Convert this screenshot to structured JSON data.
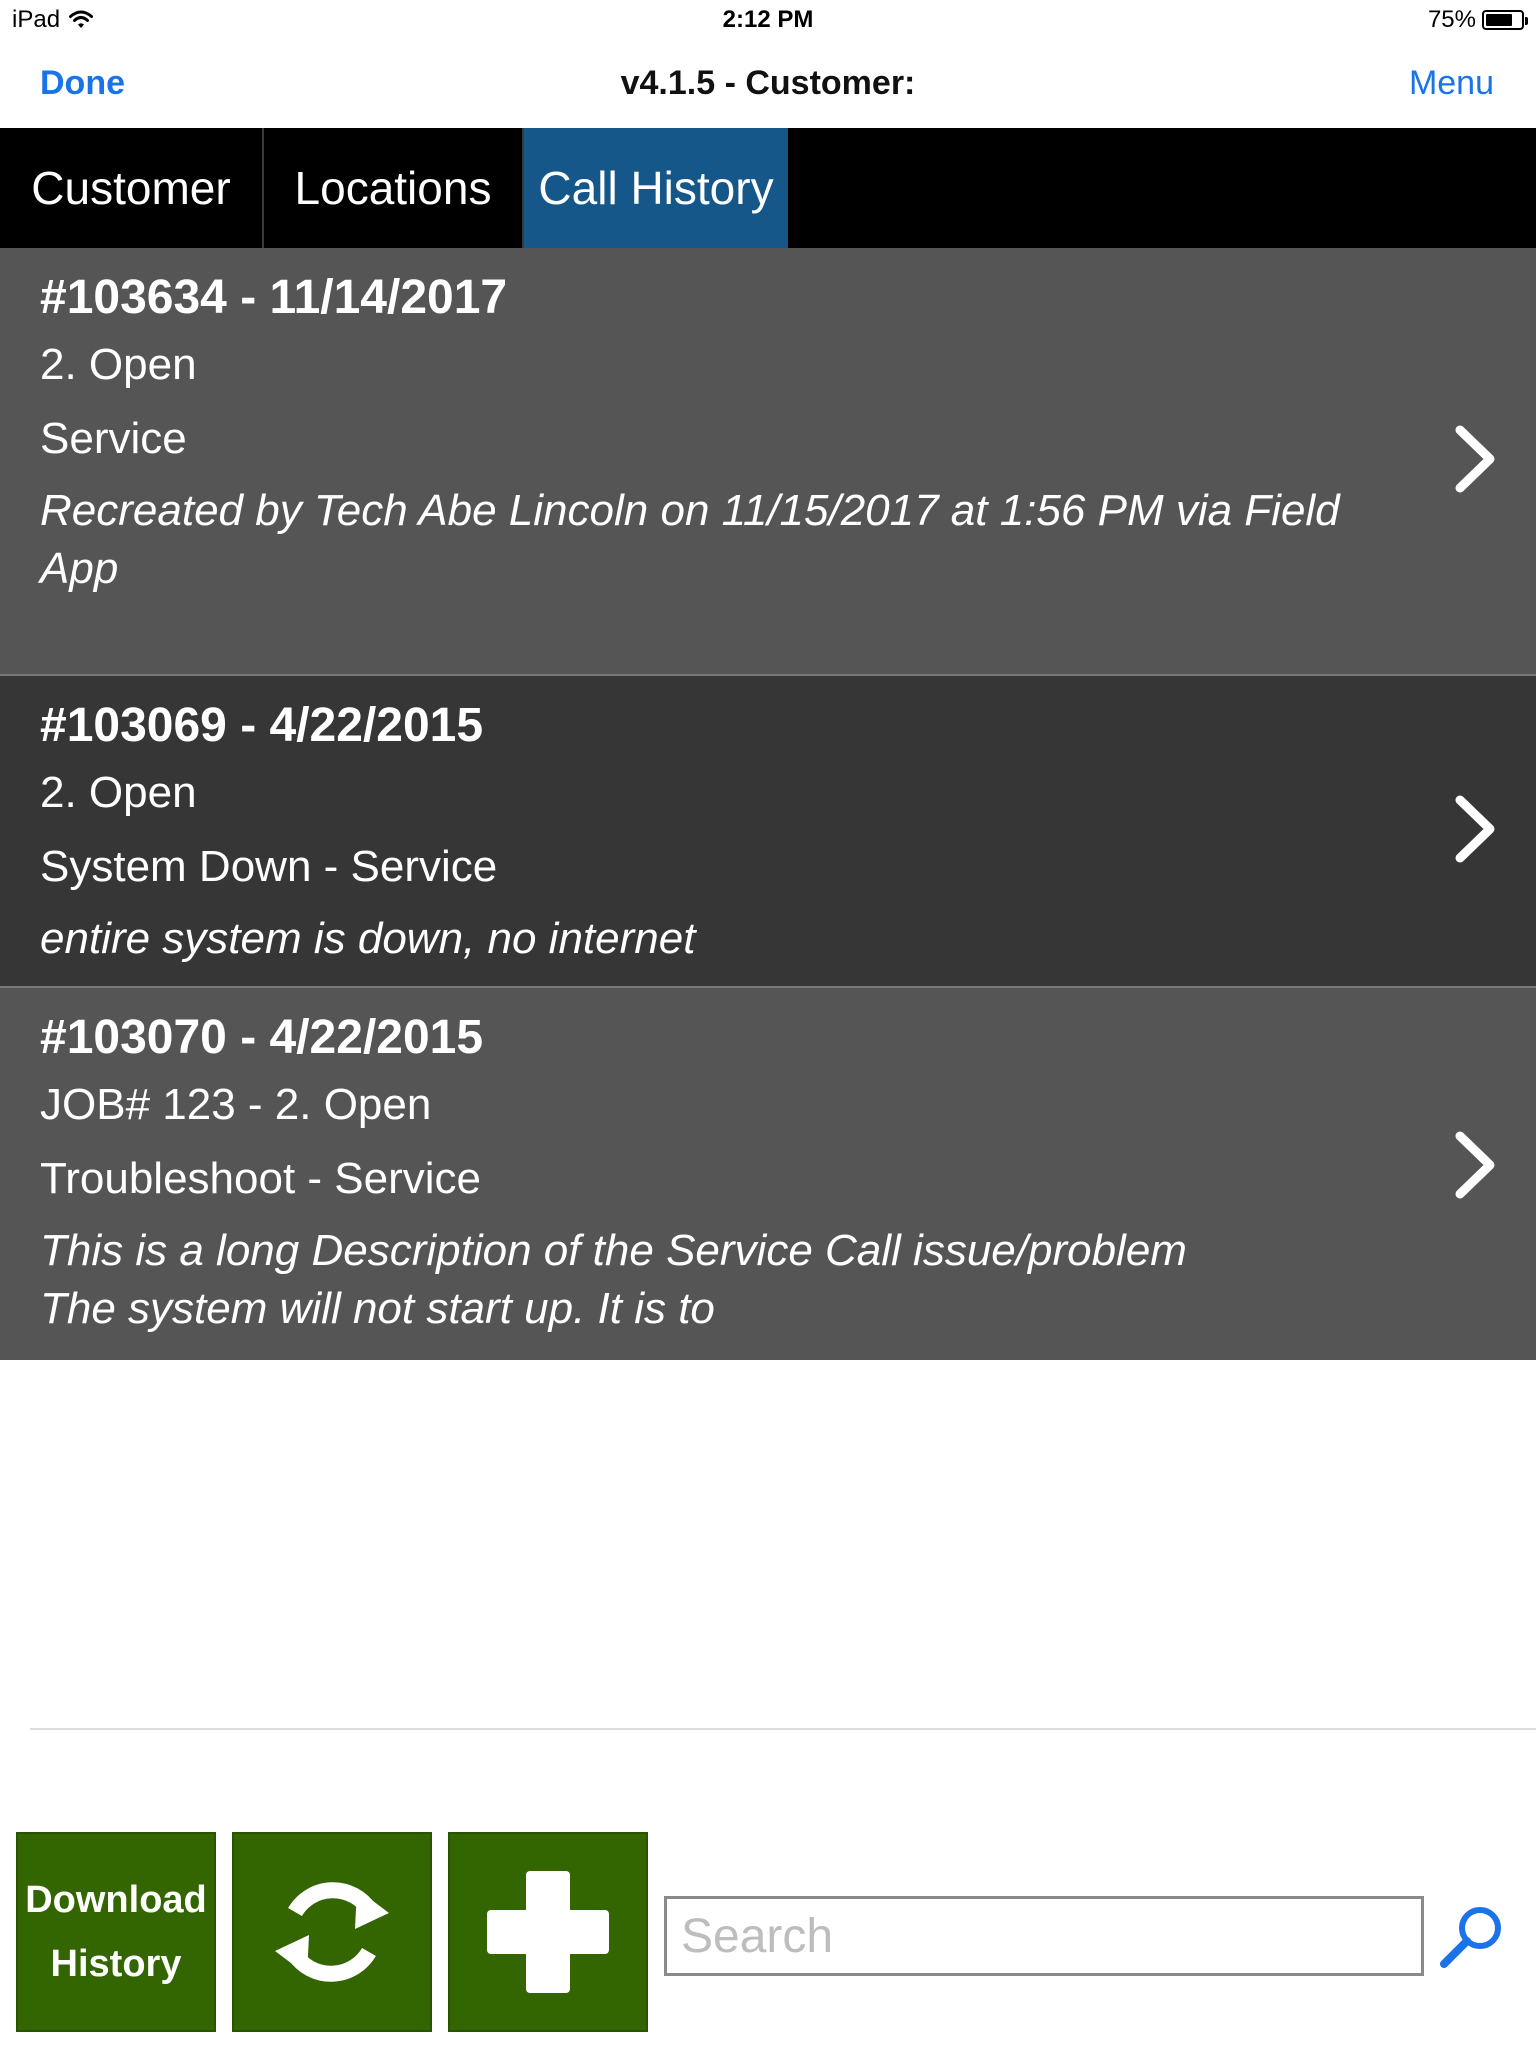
{
  "status": {
    "device": "iPad",
    "time": "2:12 PM",
    "battery_text": "75%",
    "battery_level": 0.75
  },
  "navbar": {
    "done_label": "Done",
    "title": "v4.1.5 - Customer:",
    "menu_label": "Menu"
  },
  "tabs": [
    {
      "label": "Customer",
      "active": false
    },
    {
      "label": "Locations",
      "active": false
    },
    {
      "label": "Call History",
      "active": true
    }
  ],
  "calls": [
    {
      "title": "#103634 - 11/14/2017",
      "line1": "2. Open",
      "line2": "Service",
      "description": "Recreated by Tech Abe Lincoln on 11/15/2017 at 1:56 PM via Field App",
      "icon": "chevron-right-icon"
    },
    {
      "title": "#103069 - 4/22/2015",
      "line1": "2. Open",
      "line2": "System Down - Service",
      "description": "entire system is down, no internet",
      "icon": "chevron-right-icon"
    },
    {
      "title": "#103070 - 4/22/2015",
      "line1": "JOB# 123 - 2. Open",
      "line2": "Troubleshoot - Service",
      "description": "This is a long Description of the Service Call issue/problem The system will not start up.  It is to",
      "icon": "chevron-right-icon"
    }
  ],
  "toolbar": {
    "download_label_line1": "Download",
    "download_label_line2": "History",
    "refresh_icon": "refresh-icon",
    "add_icon": "plus-icon",
    "search_placeholder": "Search",
    "search_icon": "search-icon"
  },
  "colors": {
    "accent_blue": "#1a73e8",
    "tab_active": "#155789",
    "row_light": "#555555",
    "row_dark": "#363636",
    "button_green": "#336600"
  }
}
